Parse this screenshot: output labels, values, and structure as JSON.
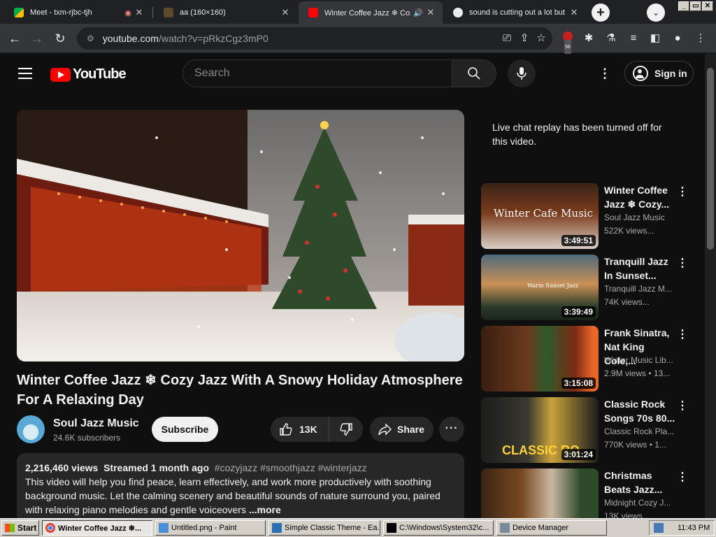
{
  "browser": {
    "tabs": [
      {
        "title": "Meet - txm-rjbc-tjh",
        "extra": "",
        "active": false
      },
      {
        "title": "aa (160×160)",
        "extra": "",
        "active": false
      },
      {
        "title": "Winter Coffee Jazz ❄ Cozy",
        "extra": "🔊",
        "active": true
      },
      {
        "title": "sound is cutting out a lot but",
        "extra": "",
        "active": false
      }
    ],
    "url_host": "youtube.com",
    "url_path": "/watch?v=pRkzCgz3mP0",
    "ext_badge": "56"
  },
  "yt": {
    "logo_text": "YouTube",
    "search_placeholder": "Search",
    "sign_in": "Sign in"
  },
  "video": {
    "title": "Winter Coffee Jazz ❄ Cozy Jazz With A Snowy Holiday Atmosphere For A Relaxing Day",
    "channel": "Soul Jazz Music",
    "subscribers": "24.6K subscribers",
    "subscribe_label": "Subscribe",
    "likes": "13K",
    "share_label": "Share",
    "views": "2,216,460 views",
    "streamed": "Streamed 1 month ago",
    "tags": "#cozyjazz #smoothjazz #winterjazz",
    "description": "This video will help you find peace, learn effectively, and work more productively with soothing background music. Let the calming scenery and beautiful sounds of nature surround you, paired with relaxing piano melodies and gentle voiceovers",
    "more": "...more"
  },
  "sidebar": {
    "chat_note": "Live chat replay has been turned off for this video.",
    "recs": [
      {
        "title": "Winter Coffee Jazz ❄ Cozy...",
        "channel": "Soul Jazz Music",
        "meta": "522K views...",
        "duration": "3:49:51",
        "thumb_text": "Winter Cafe Music"
      },
      {
        "title": "Tranquill Jazz In Sunset...",
        "channel": "Tranquill Jazz M...",
        "meta": "74K views...",
        "duration": "3:39:49",
        "thumb_text": "Warm Sunset Jazz"
      },
      {
        "title": "Frank Sinatra, Nat King Cole,...",
        "channel": "Winter Music Lib...",
        "meta": "2.9M views • 13...",
        "duration": "3:15:08",
        "thumb_text": ""
      },
      {
        "title": "Classic Rock Songs 70s 80...",
        "channel": "Classic Rock Pla...",
        "meta": "770K views • 1...",
        "duration": "3:01:24",
        "thumb_text": "CLASSIC RO"
      },
      {
        "title": "Christmas Beats Jazz...",
        "channel": "Midnight Cozy J...",
        "meta": "13K views...",
        "duration": "",
        "thumb_text": ""
      }
    ]
  },
  "taskbar": {
    "start": "Start",
    "items": [
      {
        "label": "Winter Coffee Jazz ❄...",
        "active": true
      },
      {
        "label": "Untitled.png - Paint",
        "active": false
      },
      {
        "label": "Simple Classic Theme - Ea...",
        "active": false
      },
      {
        "label": "C:\\Windows\\System32\\c...",
        "active": false
      },
      {
        "label": "Device Manager",
        "active": false
      }
    ],
    "clock": "11:43 PM"
  }
}
